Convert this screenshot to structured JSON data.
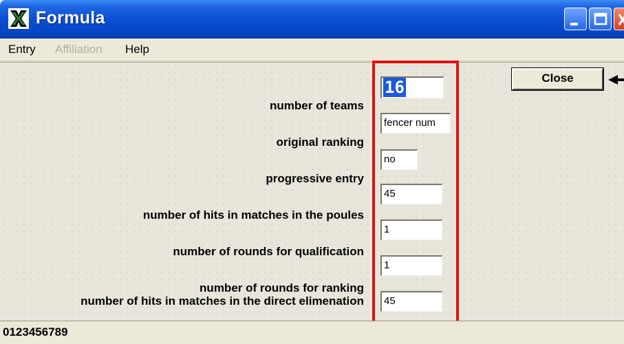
{
  "window": {
    "title": "Formula"
  },
  "menu": {
    "items": [
      {
        "label": "Entry",
        "enabled": true
      },
      {
        "label": "Affiliation",
        "enabled": false
      },
      {
        "label": "Help",
        "enabled": true
      }
    ]
  },
  "form": {
    "fields": [
      {
        "label": "number of teams",
        "value": "16"
      },
      {
        "label": "original ranking",
        "value": "fencer num"
      },
      {
        "label": "progressive entry",
        "value": "no"
      },
      {
        "label": "number of hits in matches in the poules",
        "value": "45"
      },
      {
        "label": "number of rounds for qualification",
        "value": "1"
      },
      {
        "label": "number of rounds for ranking",
        "value": "1"
      },
      {
        "label": "number of hits in matches in the direct elimenation",
        "value": "45"
      }
    ]
  },
  "buttons": {
    "close_label": "Close"
  },
  "status": {
    "text": "0123456789"
  },
  "colors": {
    "highlight": "#e01010",
    "selection": "#1a5adc"
  }
}
